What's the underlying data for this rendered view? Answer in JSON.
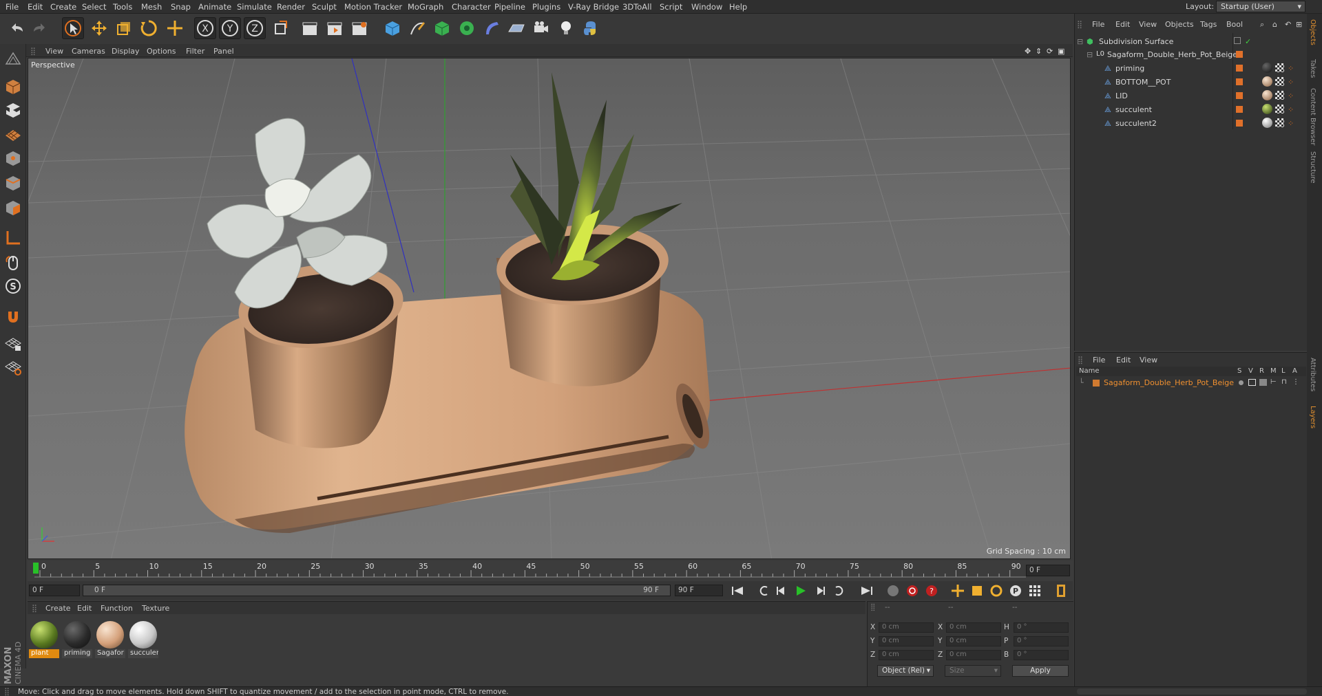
{
  "menubar": {
    "items": [
      "File",
      "Edit",
      "Create",
      "Select",
      "Tools",
      "Mesh",
      "Snap",
      "Animate",
      "Simulate",
      "Render",
      "Sculpt",
      "Motion Tracker",
      "MoGraph",
      "Character",
      "Pipeline",
      "Plugins",
      "V-Ray Bridge",
      "3DToAll",
      "Script",
      "Window",
      "Help"
    ],
    "layout_label": "Layout:",
    "layout_value": "Startup (User)"
  },
  "toolbar": {
    "axis_x": "X",
    "axis_y": "Y",
    "axis_z": "Z"
  },
  "viewport": {
    "menu": [
      "View",
      "Cameras",
      "Display",
      "Options",
      "Filter",
      "Panel"
    ],
    "label": "Perspective",
    "grid_spacing": "Grid Spacing : 10 cm"
  },
  "timeline": {
    "ticks": [
      "0",
      "5",
      "10",
      "15",
      "20",
      "25",
      "30",
      "35",
      "40",
      "45",
      "50",
      "55",
      "60",
      "65",
      "70",
      "75",
      "80",
      "85",
      "90"
    ],
    "current_frame": "0 F"
  },
  "transport": {
    "start_field": "0 F",
    "range_start": "0 F",
    "range_end": "90 F",
    "end_field": "90 F"
  },
  "materials": {
    "menu": [
      "Create",
      "Edit",
      "Function",
      "Texture"
    ],
    "items": [
      {
        "label": "plant",
        "color": "#7a9a3a"
      },
      {
        "label": "priming",
        "color": "#2a2a2a"
      },
      {
        "label": "Sagafor",
        "color": "#d4a07a"
      },
      {
        "label": "succulen",
        "color": "#c8c8c8"
      }
    ]
  },
  "coordinates": {
    "header_dashes": [
      "--",
      "--",
      "--"
    ],
    "rows": [
      {
        "a": "X",
        "av": "0 cm",
        "b": "X",
        "bv": "0 cm",
        "c": "H",
        "cv": "0 °"
      },
      {
        "a": "Y",
        "av": "0 cm",
        "b": "Y",
        "bv": "0 cm",
        "c": "P",
        "cv": "0 °"
      },
      {
        "a": "Z",
        "av": "0 cm",
        "b": "Z",
        "bv": "0 cm",
        "c": "B",
        "cv": "0 °"
      }
    ],
    "mode": "Object (Rel)",
    "size": "Size",
    "apply": "Apply"
  },
  "object_manager": {
    "menu": [
      "File",
      "Edit",
      "View",
      "Objects",
      "Tags",
      "Bool"
    ],
    "objects": [
      {
        "name": "Subdivision Surface",
        "level": 0
      },
      {
        "name": "Sagaform_Double_Herb_Pot_Beige",
        "level": 1
      },
      {
        "name": "priming",
        "level": 2
      },
      {
        "name": "BOTTOM__POT",
        "level": 2
      },
      {
        "name": "LID",
        "level": 2
      },
      {
        "name": "succulent",
        "level": 2
      },
      {
        "name": "succulent2",
        "level": 2
      }
    ]
  },
  "layer_manager": {
    "menu": [
      "File",
      "Edit",
      "View"
    ],
    "columns": [
      "Name",
      "S",
      "V",
      "R",
      "M",
      "L",
      "A"
    ],
    "layers": [
      {
        "name": "Sagaform_Double_Herb_Pot_Beige",
        "color": "#d07a30"
      }
    ]
  },
  "side_tabs": [
    "Objects",
    "Takes",
    "Content Browser",
    "Structure",
    "Attributes",
    "Layers"
  ],
  "status": "Move: Click and drag to move elements. Hold down SHIFT to quantize movement / add to the selection in point mode, CTRL to remove.",
  "brand": "MAXON CINEMA 4D"
}
